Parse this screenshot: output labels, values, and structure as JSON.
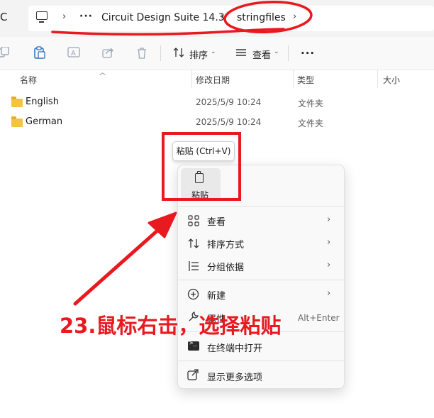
{
  "address_bar": {
    "refresh_glyph": "C",
    "chevron": "›",
    "more": "···",
    "breadcrumbs": [
      "Circuit Design Suite 14.3",
      "stringfiles"
    ]
  },
  "toolbar": {
    "sort_label": "排序",
    "view_label": "查看",
    "more": "···",
    "caret": "⌄"
  },
  "file_list": {
    "columns": {
      "name": "名称",
      "modified": "修改日期",
      "type": "类型",
      "size": "大小"
    },
    "rows": [
      {
        "name": "English",
        "modified": "2025/5/9 10:24",
        "type": "文件夹",
        "size": ""
      },
      {
        "name": "German",
        "modified": "2025/5/9 10:24",
        "type": "文件夹",
        "size": ""
      }
    ]
  },
  "context_menu": {
    "tooltip": "粘贴 (Ctrl+V)",
    "paste_label": "粘贴",
    "items": [
      {
        "label": "查看",
        "icon": "grid-icon",
        "has_submenu": true
      },
      {
        "label": "排序方式",
        "icon": "sort-icon",
        "has_submenu": true
      },
      {
        "label": "分组依据",
        "icon": "group-icon",
        "has_submenu": true
      },
      {
        "label": "新建",
        "icon": "plus-circle-icon",
        "has_submenu": true
      },
      {
        "label": "属性",
        "icon": "wrench-icon",
        "shortcut": "Alt+Enter"
      },
      {
        "label": "在终端中打开",
        "icon": "terminal-icon"
      },
      {
        "label": "显示更多选项",
        "icon": "external-icon"
      }
    ]
  },
  "annotation": {
    "text": "23.鼠标右击，选择粘贴",
    "color": "#e8191f"
  }
}
